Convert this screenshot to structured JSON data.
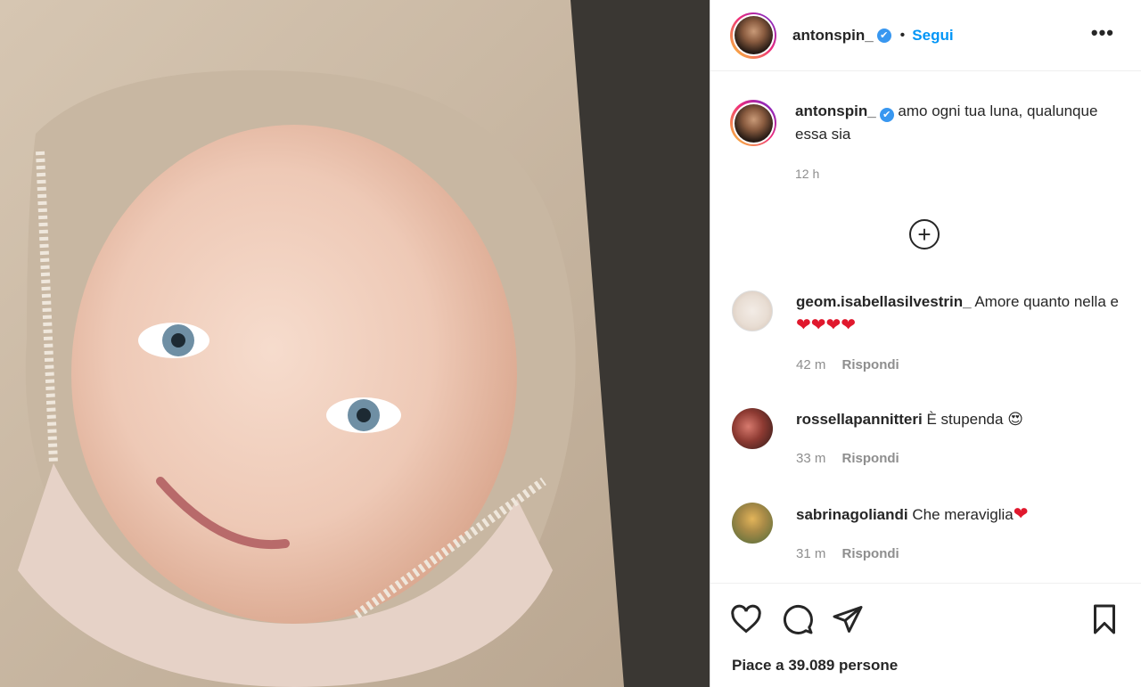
{
  "post": {
    "username": "antonspin_",
    "verified_mark": "✔",
    "separator": "•",
    "follow_label": "Segui",
    "more_label": "•••",
    "caption": "amo ogni tua luna, qualunque essa sia",
    "caption_time": "12 h",
    "load_more_label": "+",
    "likes_text": "Piace a 39.089 persone"
  },
  "comments": [
    {
      "user": "geom.isabellasilvestrin_",
      "text": "Amore quanto nella e",
      "emoji": "❤❤❤❤",
      "time": "42 m",
      "reply": "Rispondi"
    },
    {
      "user": "rossellapannitteri",
      "text": "È stupenda",
      "emoji": "😍",
      "time": "33 m",
      "reply": "Rispondi"
    },
    {
      "user": "sabrinagoliandi",
      "text": "Che meraviglia",
      "emoji": "❤",
      "time": "31 m",
      "reply": "Rispondi"
    }
  ],
  "icons": {
    "like": "heart-outline-icon",
    "comment": "speech-bubble-icon",
    "share": "paper-plane-icon",
    "save": "bookmark-icon"
  },
  "colors": {
    "accent": "#0095f6",
    "verified": "#3897f0",
    "heart": "#e0182d",
    "meta": "#8e8e8e"
  }
}
